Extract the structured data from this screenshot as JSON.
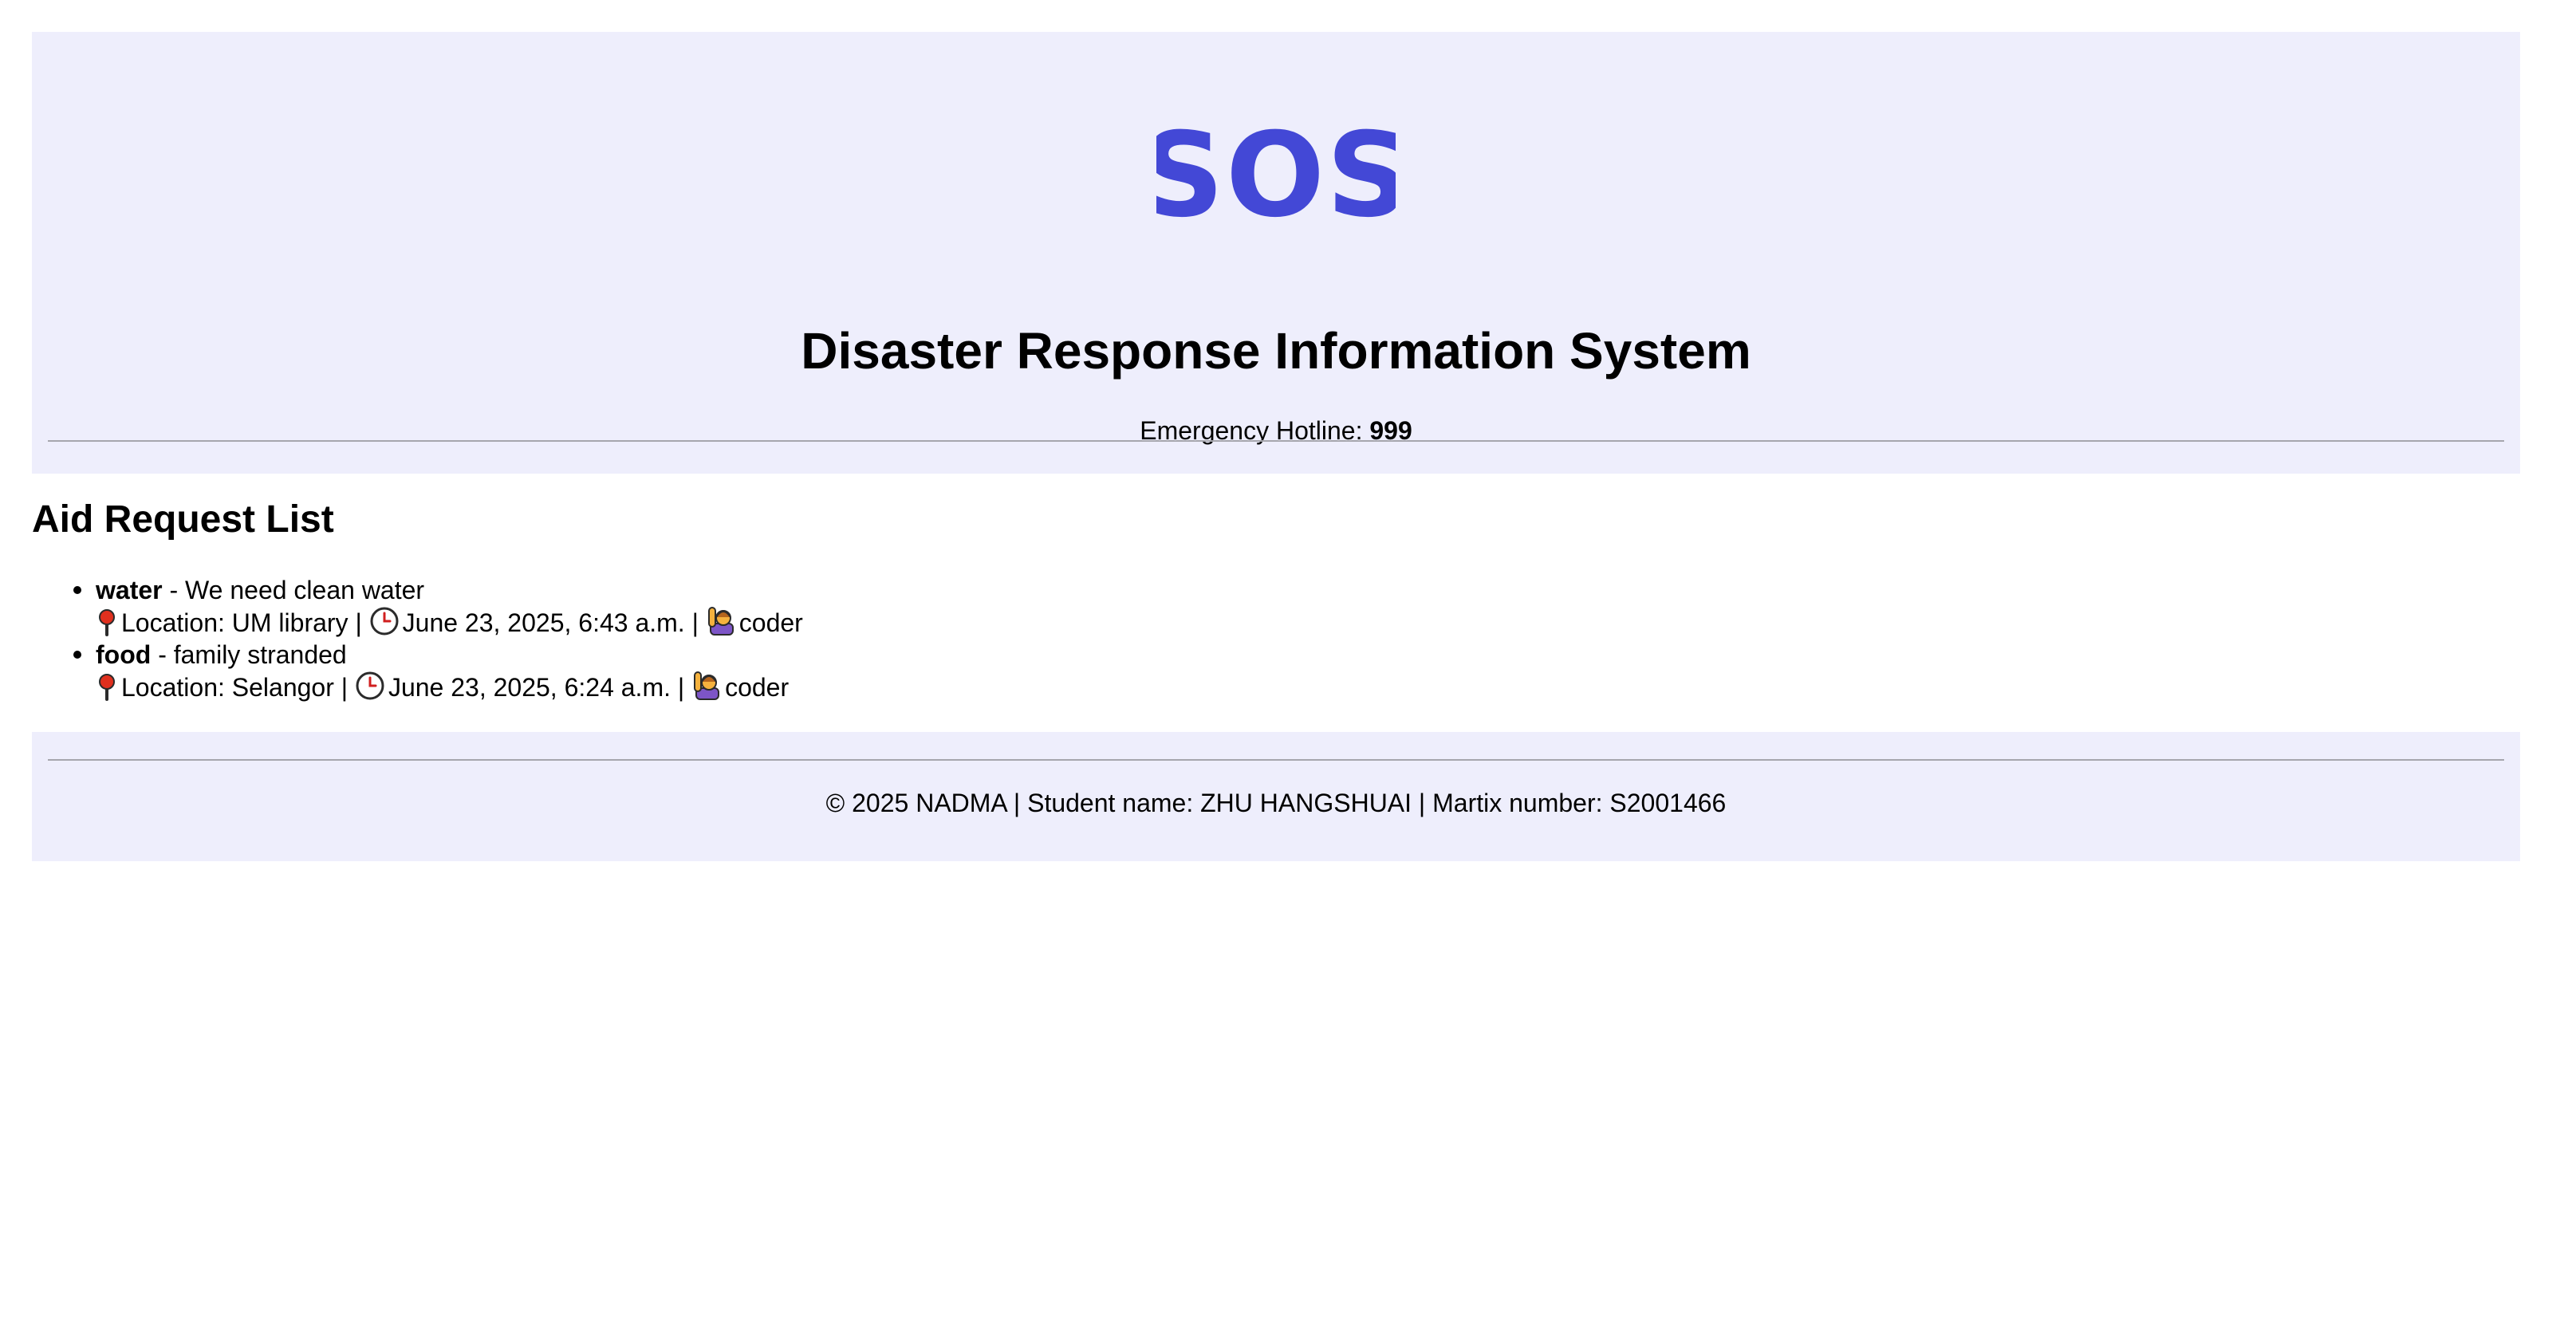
{
  "header": {
    "logo_text": "SOS",
    "title": "Disaster Response Information System",
    "hotline_label": "Emergency Hotline:",
    "hotline_number": "999"
  },
  "main": {
    "section_title": "Aid Request List",
    "requests": [
      {
        "category": "water",
        "separator": "-",
        "description": "We need clean water",
        "location": "Location: UM library",
        "timestamp": "June 23, 2025, 6:43 a.m.",
        "user": "coder"
      },
      {
        "category": "food",
        "separator": "-",
        "description": "family stranded",
        "location": "Location: Selangor",
        "timestamp": "June 23, 2025, 6:24 a.m.",
        "user": "coder"
      }
    ]
  },
  "footer": {
    "text": "© 2025 NADMA | Student name: ZHU HANGSHUAI | Martix number: S2001466"
  },
  "colors": {
    "banner_background": "#eeeefc",
    "logo": "#4348d6",
    "rule": "#a6a6ad"
  },
  "icons": [
    "pin-icon",
    "clock-icon",
    "person-raising-hand-icon"
  ]
}
